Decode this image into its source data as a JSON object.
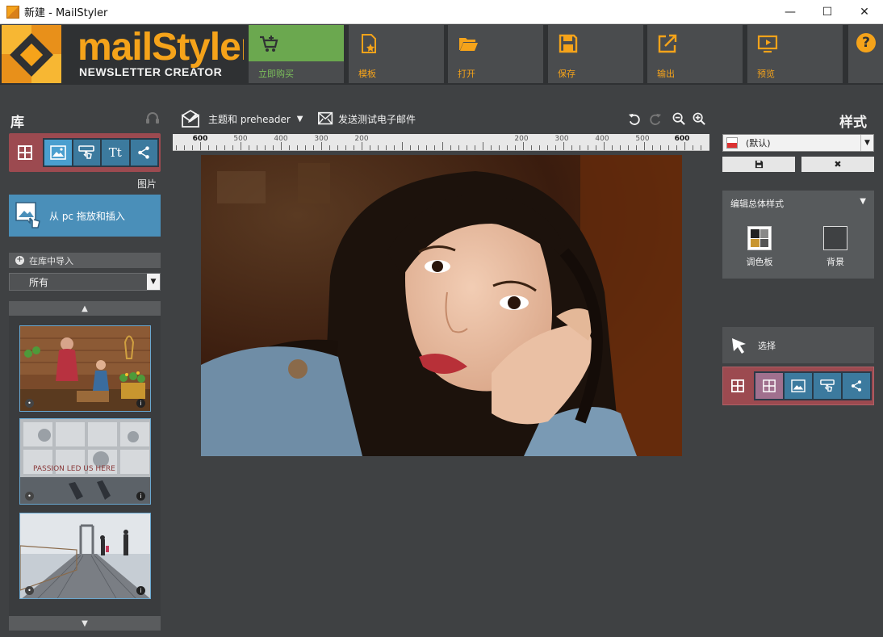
{
  "window": {
    "title": "新建 - MailStyler",
    "controls": [
      "—",
      "☐",
      "✕"
    ]
  },
  "logo": {
    "main": "mailStyler",
    "sub": "NEWSLETTER CREATOR"
  },
  "toolbar": [
    {
      "id": "buy",
      "label": "立即购买",
      "icon": "cart-icon"
    },
    {
      "id": "templates",
      "label": "模板",
      "icon": "template-icon"
    },
    {
      "id": "open",
      "label": "打开",
      "icon": "folder-icon"
    },
    {
      "id": "save",
      "label": "保存",
      "icon": "save-icon"
    },
    {
      "id": "export",
      "label": "输出",
      "icon": "export-icon"
    },
    {
      "id": "preview",
      "label": "预览",
      "icon": "preview-icon"
    }
  ],
  "help": {
    "label": "?"
  },
  "library": {
    "title": "库",
    "tabs": [
      {
        "icon": "image-icon",
        "glyph": "🖼"
      },
      {
        "icon": "button-icon",
        "glyph": "☝"
      },
      {
        "icon": "text-icon",
        "glyph": "Tt"
      },
      {
        "icon": "share-icon",
        "glyph": "<"
      }
    ],
    "caption": "图片",
    "drop_label": "从 pc 拖放和插入",
    "import_label": "在库中导入",
    "filter": "所有",
    "thumbnails": [
      {
        "theme": "gardening",
        "text": ""
      },
      {
        "theme": "tiles",
        "text": "PASSION LED US HERE"
      },
      {
        "theme": "bridge",
        "text": ""
      }
    ]
  },
  "canvas_toolbar": {
    "subject": "主题和 preheader",
    "test_email": "发送测试电子邮件"
  },
  "ruler": {
    "left": [
      "600",
      "500",
      "400",
      "300",
      "200"
    ],
    "right": [
      "200",
      "300",
      "400",
      "500",
      "600"
    ]
  },
  "styles": {
    "title": "样式",
    "selected": "(默认)",
    "save_glyph": "💾",
    "delete_glyph": "✖",
    "global_header": "编辑总体样式",
    "palette": "调色板",
    "background": "背景",
    "select_label": "选择"
  },
  "colors": {
    "accent": "#f5a31a",
    "buy": "#6ba84f",
    "tab": "#3c7a9e",
    "tab_active": "#4a9fcf",
    "tab_frame": "#9c4a50"
  }
}
